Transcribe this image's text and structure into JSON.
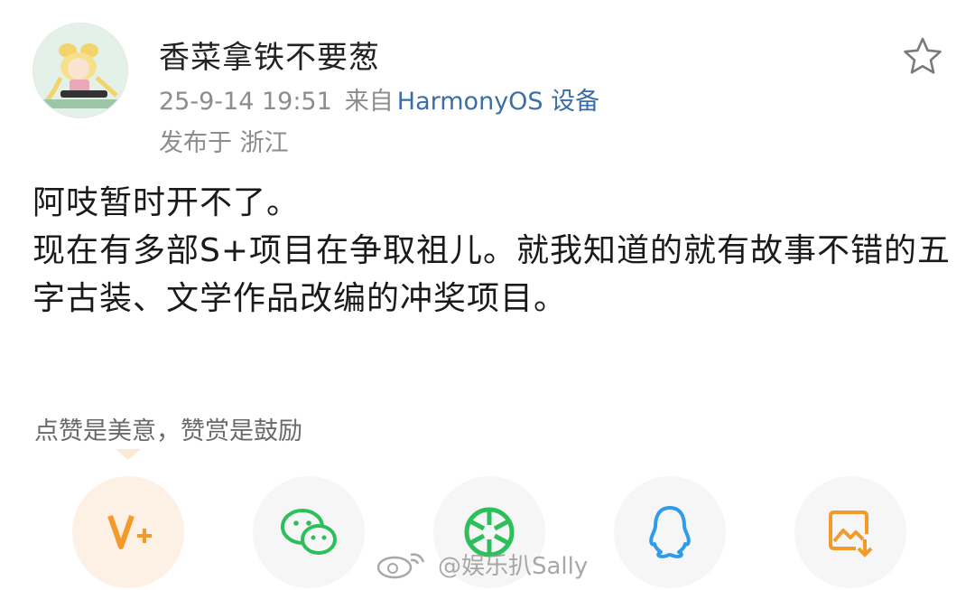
{
  "post": {
    "author": "香菜拿铁不要葱",
    "time": "25-9-14 19:51",
    "source_prefix": "来自",
    "device": "HarmonyOS 设备",
    "location": "发布于 浙江",
    "lines": [
      "阿吱暂时开不了。",
      "现在有多部S+项目在争取祖儿。就我知道的就有故事不错的五字古装、文学作品改编的冲奖项目。"
    ]
  },
  "tip": "点赞是美意，赞赏是鼓励",
  "share_buttons": [
    {
      "name": "weibo-vplus",
      "icon": "v-plus-icon",
      "color": "#f39a2b"
    },
    {
      "name": "wechat",
      "icon": "wechat-icon",
      "color": "#2dbf5c"
    },
    {
      "name": "moments",
      "icon": "moments-icon",
      "color": "#2dbf5c"
    },
    {
      "name": "qq",
      "icon": "qq-icon",
      "color": "#2f9ce8"
    },
    {
      "name": "save-image",
      "icon": "save-image-icon",
      "color": "#f39a2b"
    }
  ],
  "watermark": "@娱乐扒Sally"
}
